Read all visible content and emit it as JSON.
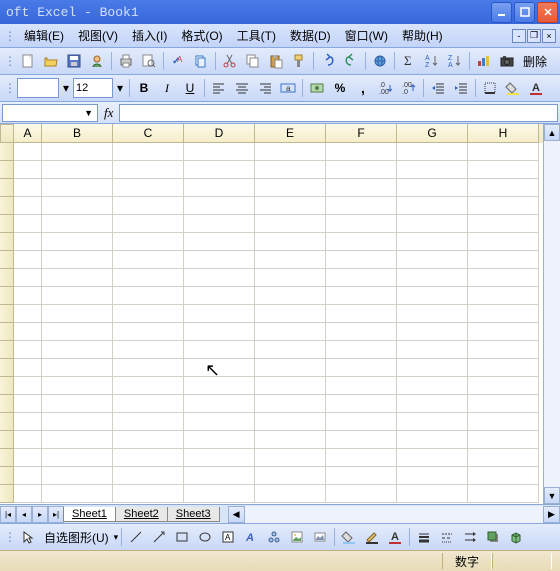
{
  "window": {
    "title": "oft Excel - Book1"
  },
  "menu": {
    "edit": "编辑(E)",
    "view": "视图(V)",
    "insert": "插入(I)",
    "format": "格式(O)",
    "tools": "工具(T)",
    "data": "数据(D)",
    "window": "窗口(W)",
    "help": "帮助(H)"
  },
  "toolbar": {
    "delete": "删除"
  },
  "format": {
    "font": "",
    "size": "12",
    "bold": "B",
    "italic": "I",
    "underline": "U",
    "percent": "%",
    "comma": ","
  },
  "formulabar": {
    "name": "",
    "fx": "fx"
  },
  "columns": [
    "A",
    "B",
    "C",
    "D",
    "E",
    "F",
    "G",
    "H"
  ],
  "sheets": {
    "tab1": "Sheet1",
    "tab2": "Sheet2",
    "tab3": "Sheet3"
  },
  "drawbar": {
    "autoshapes": "自选图形(U)"
  },
  "status": {
    "mode": "数字"
  }
}
